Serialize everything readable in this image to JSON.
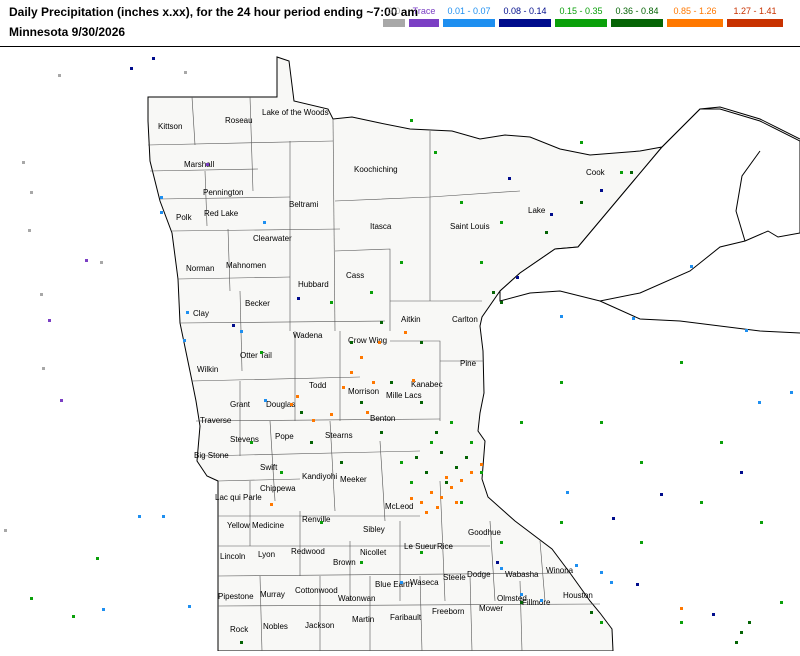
{
  "title": {
    "line1": "Daily Precipitation (inches  x.xx),  for the 24 hour period ending ~7:00 am",
    "line2": "Minnesota 9/30/2026"
  },
  "legend": [
    {
      "label": "0.0",
      "color": "#a8a8a8"
    },
    {
      "label": "Trace",
      "color": "#7b3fc4"
    },
    {
      "label": "0.01 - 0.07",
      "color": "#1e8ff0"
    },
    {
      "label": "0.08 - 0.14",
      "color": "#000c8c"
    },
    {
      "label": "0.15 - 0.35",
      "color": "#0aa00a"
    },
    {
      "label": "0.36 - 0.84",
      "color": "#056405"
    },
    {
      "label": "0.85 - 1.26",
      "color": "#ff7800"
    },
    {
      "label": "1.27 - 1.41",
      "color": "#c83200"
    }
  ],
  "colors": {
    "land": "#f8f8f6",
    "water": "#ffffff",
    "border": "#000000",
    "county_line": "#555555"
  },
  "counties": [
    "Kittson",
    "Roseau",
    "Lake of the Woods",
    "Marshall",
    "Koochiching",
    "Pennington",
    "Cook",
    "Polk",
    "Red Lake",
    "Beltrami",
    "Lake",
    "Saint Louis",
    "Itasca",
    "Clearwater",
    "Norman",
    "Mahnomen",
    "Cass",
    "Hubbard",
    "Clay",
    "Becker",
    "Aitkin",
    "Carlton",
    "Wadena",
    "Otter Tail",
    "Crow Wing",
    "Pine",
    "Wilkin",
    "Todd",
    "Morrison",
    "Kanabec",
    "Mille Lacs",
    "Grant",
    "Douglas",
    "Traverse",
    "Stevens",
    "Pope",
    "Stearns",
    "Benton",
    "Big Stone",
    "Swift",
    "Kandiyohi",
    "Meeker",
    "Chippewa",
    "Lac qui Parle",
    "Renville",
    "McLeod",
    "Yellow Medicine",
    "Sibley",
    "Nicollet",
    "Lincoln",
    "Lyon",
    "Redwood",
    "Brown",
    "Le Sueur",
    "Rice",
    "Goodhue",
    "Dodge",
    "Steele",
    "Waseca",
    "Blue Earth",
    "Winona",
    "Wabasha",
    "Olmsted",
    "Fillmore",
    "Houston",
    "Pipestone",
    "Murray",
    "Cottonwood",
    "Watonwan",
    "Rock",
    "Nobles",
    "Jackson",
    "Martin",
    "Faribault",
    "Freeborn",
    "Mower"
  ]
}
